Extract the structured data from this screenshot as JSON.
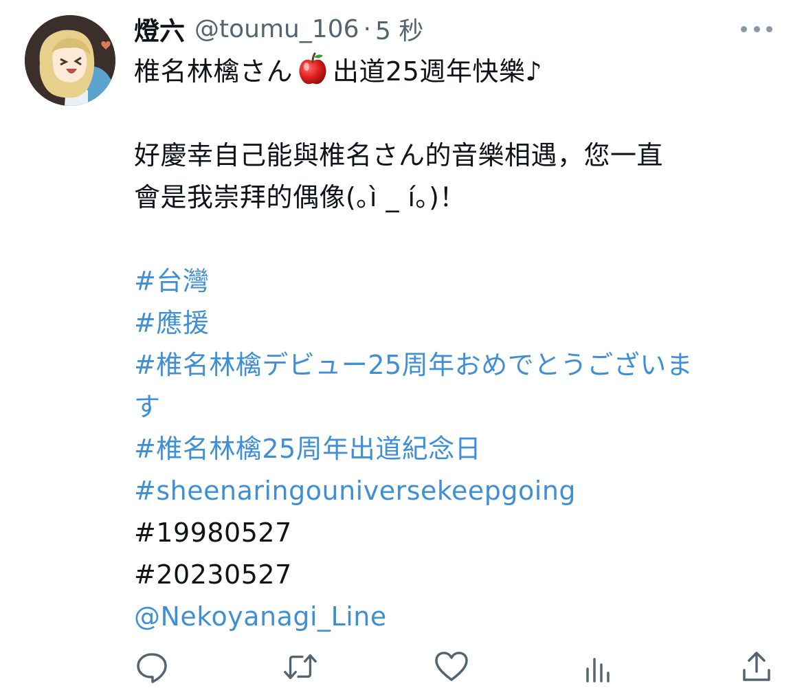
{
  "tweet": {
    "display_name": "燈六",
    "handle": "@toumu_106",
    "separator": "·",
    "time": "5 秒",
    "line1_pre": "椎名林檎さん",
    "line1_post": "出道25週年快樂♪",
    "para2_line1": "好慶幸自己能與椎名さん的音樂相遇，您一直",
    "para2_line2": "會是我崇拜的偶像(｡ì _ í｡)！",
    "hashtag_1": "#台灣",
    "hashtag_2": "#應援",
    "hashtag_3_line1": "#椎名林檎デビュー25周年おめでとうございま",
    "hashtag_3_line2": "す",
    "hashtag_4": "#椎名林檎25周年出道紀念日",
    "hashtag_5": "#sheenaringouniversekeepgoing",
    "plain_tag_1": "#19980527",
    "plain_tag_2": "#20230527",
    "mention": "@Nekoyanagi_Line"
  },
  "icons": {
    "more": "more-dots-icon",
    "reply": "reply-icon",
    "retweet": "retweet-icon",
    "like": "heart-icon",
    "views": "views-icon",
    "share": "share-icon",
    "apple": "apple-emoji"
  },
  "colors": {
    "link": "#3f8fd6",
    "text": "#0f1419",
    "muted": "#536471"
  }
}
